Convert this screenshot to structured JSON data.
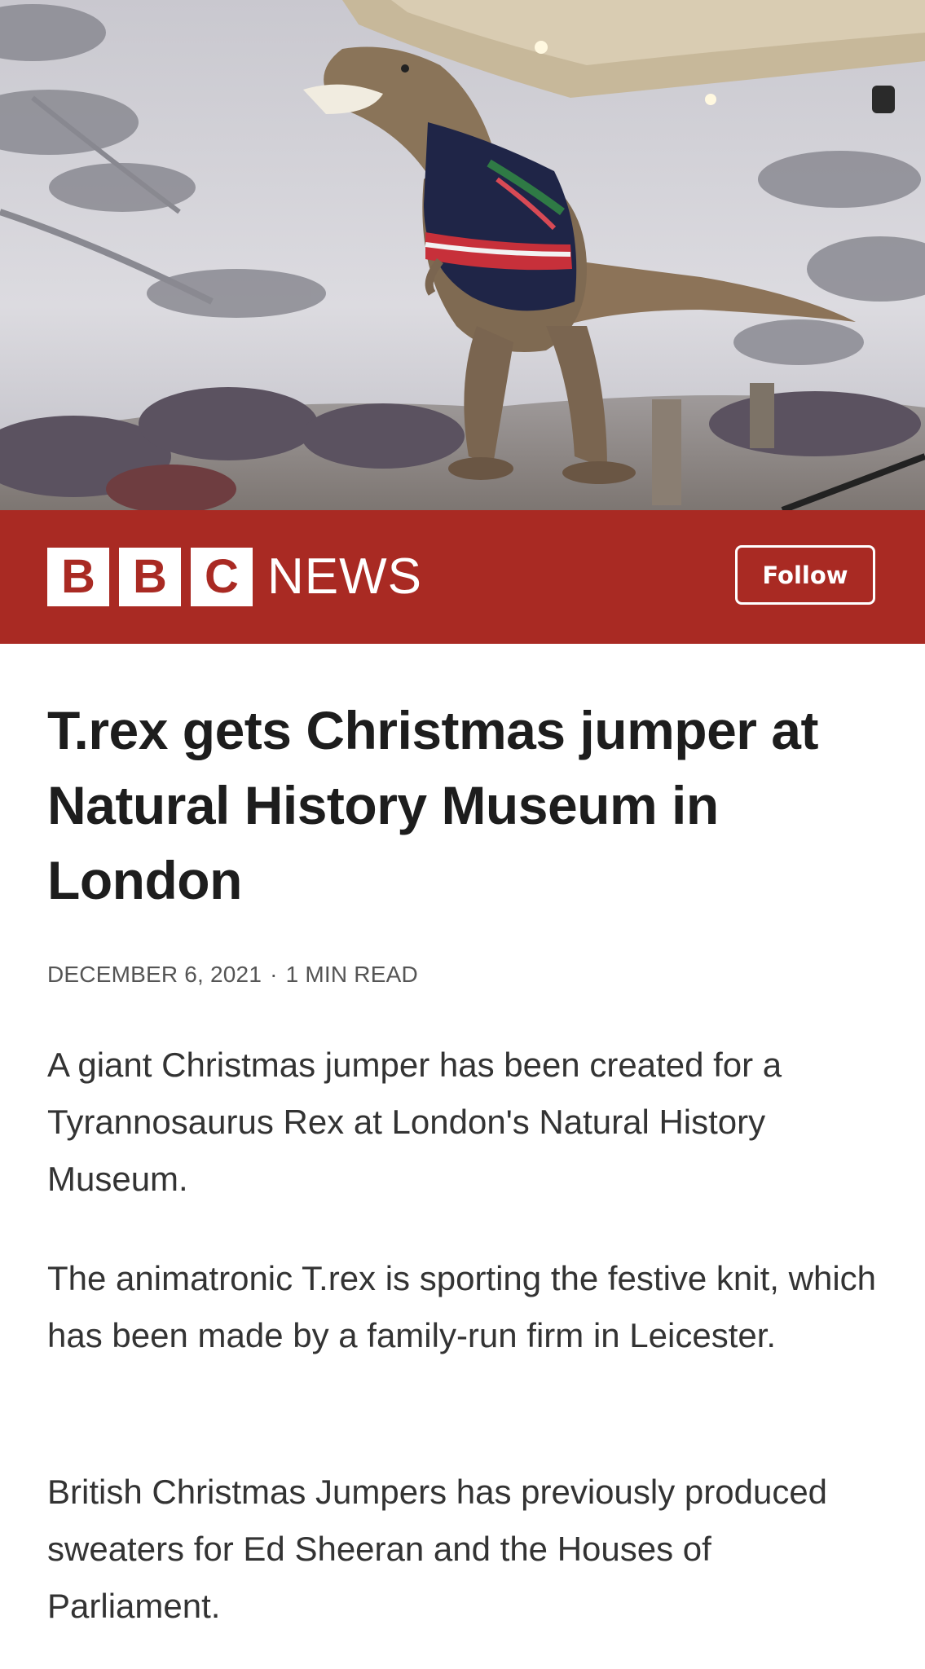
{
  "hero": {
    "alt": "T.rex wearing a Christmas jumper"
  },
  "publisher": {
    "logo_letters": [
      "B",
      "B",
      "C"
    ],
    "logo_word": "NEWS",
    "follow_label": "Follow"
  },
  "article": {
    "headline": "T.rex gets Christmas jumper at Natural History Museum in London",
    "date": "DECEMBER 6, 2021",
    "separator": "·",
    "read_time": "1 MIN READ",
    "paragraphs": [
      "A giant Christmas jumper has been created for a Tyrannosaurus Rex at London's Natural History Museum.",
      "The animatronic T.rex is sporting the festive knit, which has been made by a family-run firm in Leicester.",
      "British Christmas Jumpers has previously produced sweaters for Ed Sheeran and the Houses of Parliament."
    ]
  },
  "colors": {
    "brand_red": "#a92a23",
    "headline": "#1d1d1d",
    "body": "#333333",
    "meta": "#555555"
  }
}
